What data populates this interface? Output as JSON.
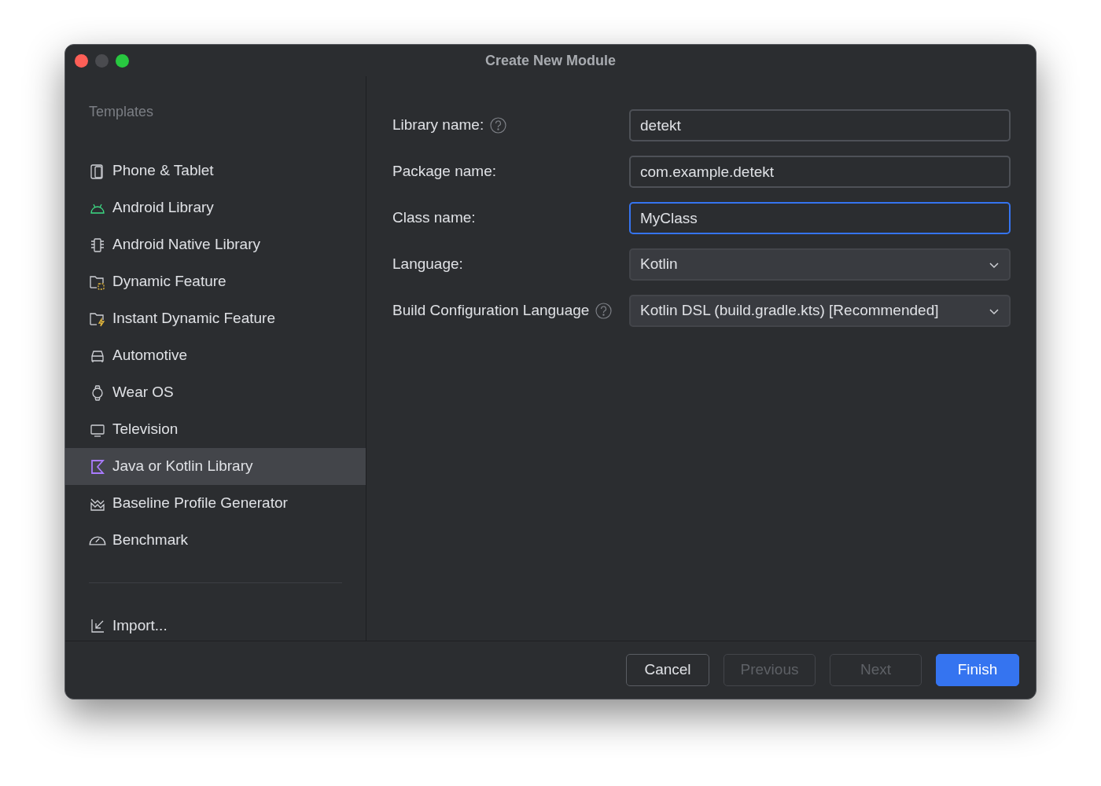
{
  "window": {
    "title": "Create New Module"
  },
  "sidebar": {
    "heading": "Templates",
    "items": [
      {
        "label": "Phone & Tablet",
        "selected": false
      },
      {
        "label": "Android Library",
        "selected": false
      },
      {
        "label": "Android Native Library",
        "selected": false
      },
      {
        "label": "Dynamic Feature",
        "selected": false
      },
      {
        "label": "Instant Dynamic Feature",
        "selected": false
      },
      {
        "label": "Automotive",
        "selected": false
      },
      {
        "label": "Wear OS",
        "selected": false
      },
      {
        "label": "Television",
        "selected": false
      },
      {
        "label": "Java or Kotlin Library",
        "selected": true
      },
      {
        "label": "Baseline Profile Generator",
        "selected": false
      },
      {
        "label": "Benchmark",
        "selected": false
      }
    ],
    "import": {
      "label": "Import..."
    }
  },
  "form": {
    "fields": [
      {
        "label": "Library name:",
        "help": true,
        "kind": "text",
        "value": "detekt",
        "focused": false
      },
      {
        "label": "Package name:",
        "help": false,
        "kind": "text",
        "value": "com.example.detekt",
        "focused": false
      },
      {
        "label": "Class name:",
        "help": false,
        "kind": "text",
        "value": "MyClass",
        "focused": true
      },
      {
        "label": "Language:",
        "help": false,
        "kind": "dropdown",
        "value": "Kotlin",
        "focused": false
      },
      {
        "label": "Build Configuration Language",
        "help": true,
        "kind": "dropdown",
        "value": "Kotlin DSL (build.gradle.kts) [Recommended]",
        "focused": false
      }
    ]
  },
  "buttons": [
    {
      "label": "Cancel",
      "kind": "secondary",
      "disabled": false
    },
    {
      "label": "Previous",
      "kind": "secondary",
      "disabled": true
    },
    {
      "label": "Next",
      "kind": "secondary",
      "disabled": true
    },
    {
      "label": "Finish",
      "kind": "primary",
      "disabled": false
    }
  ]
}
